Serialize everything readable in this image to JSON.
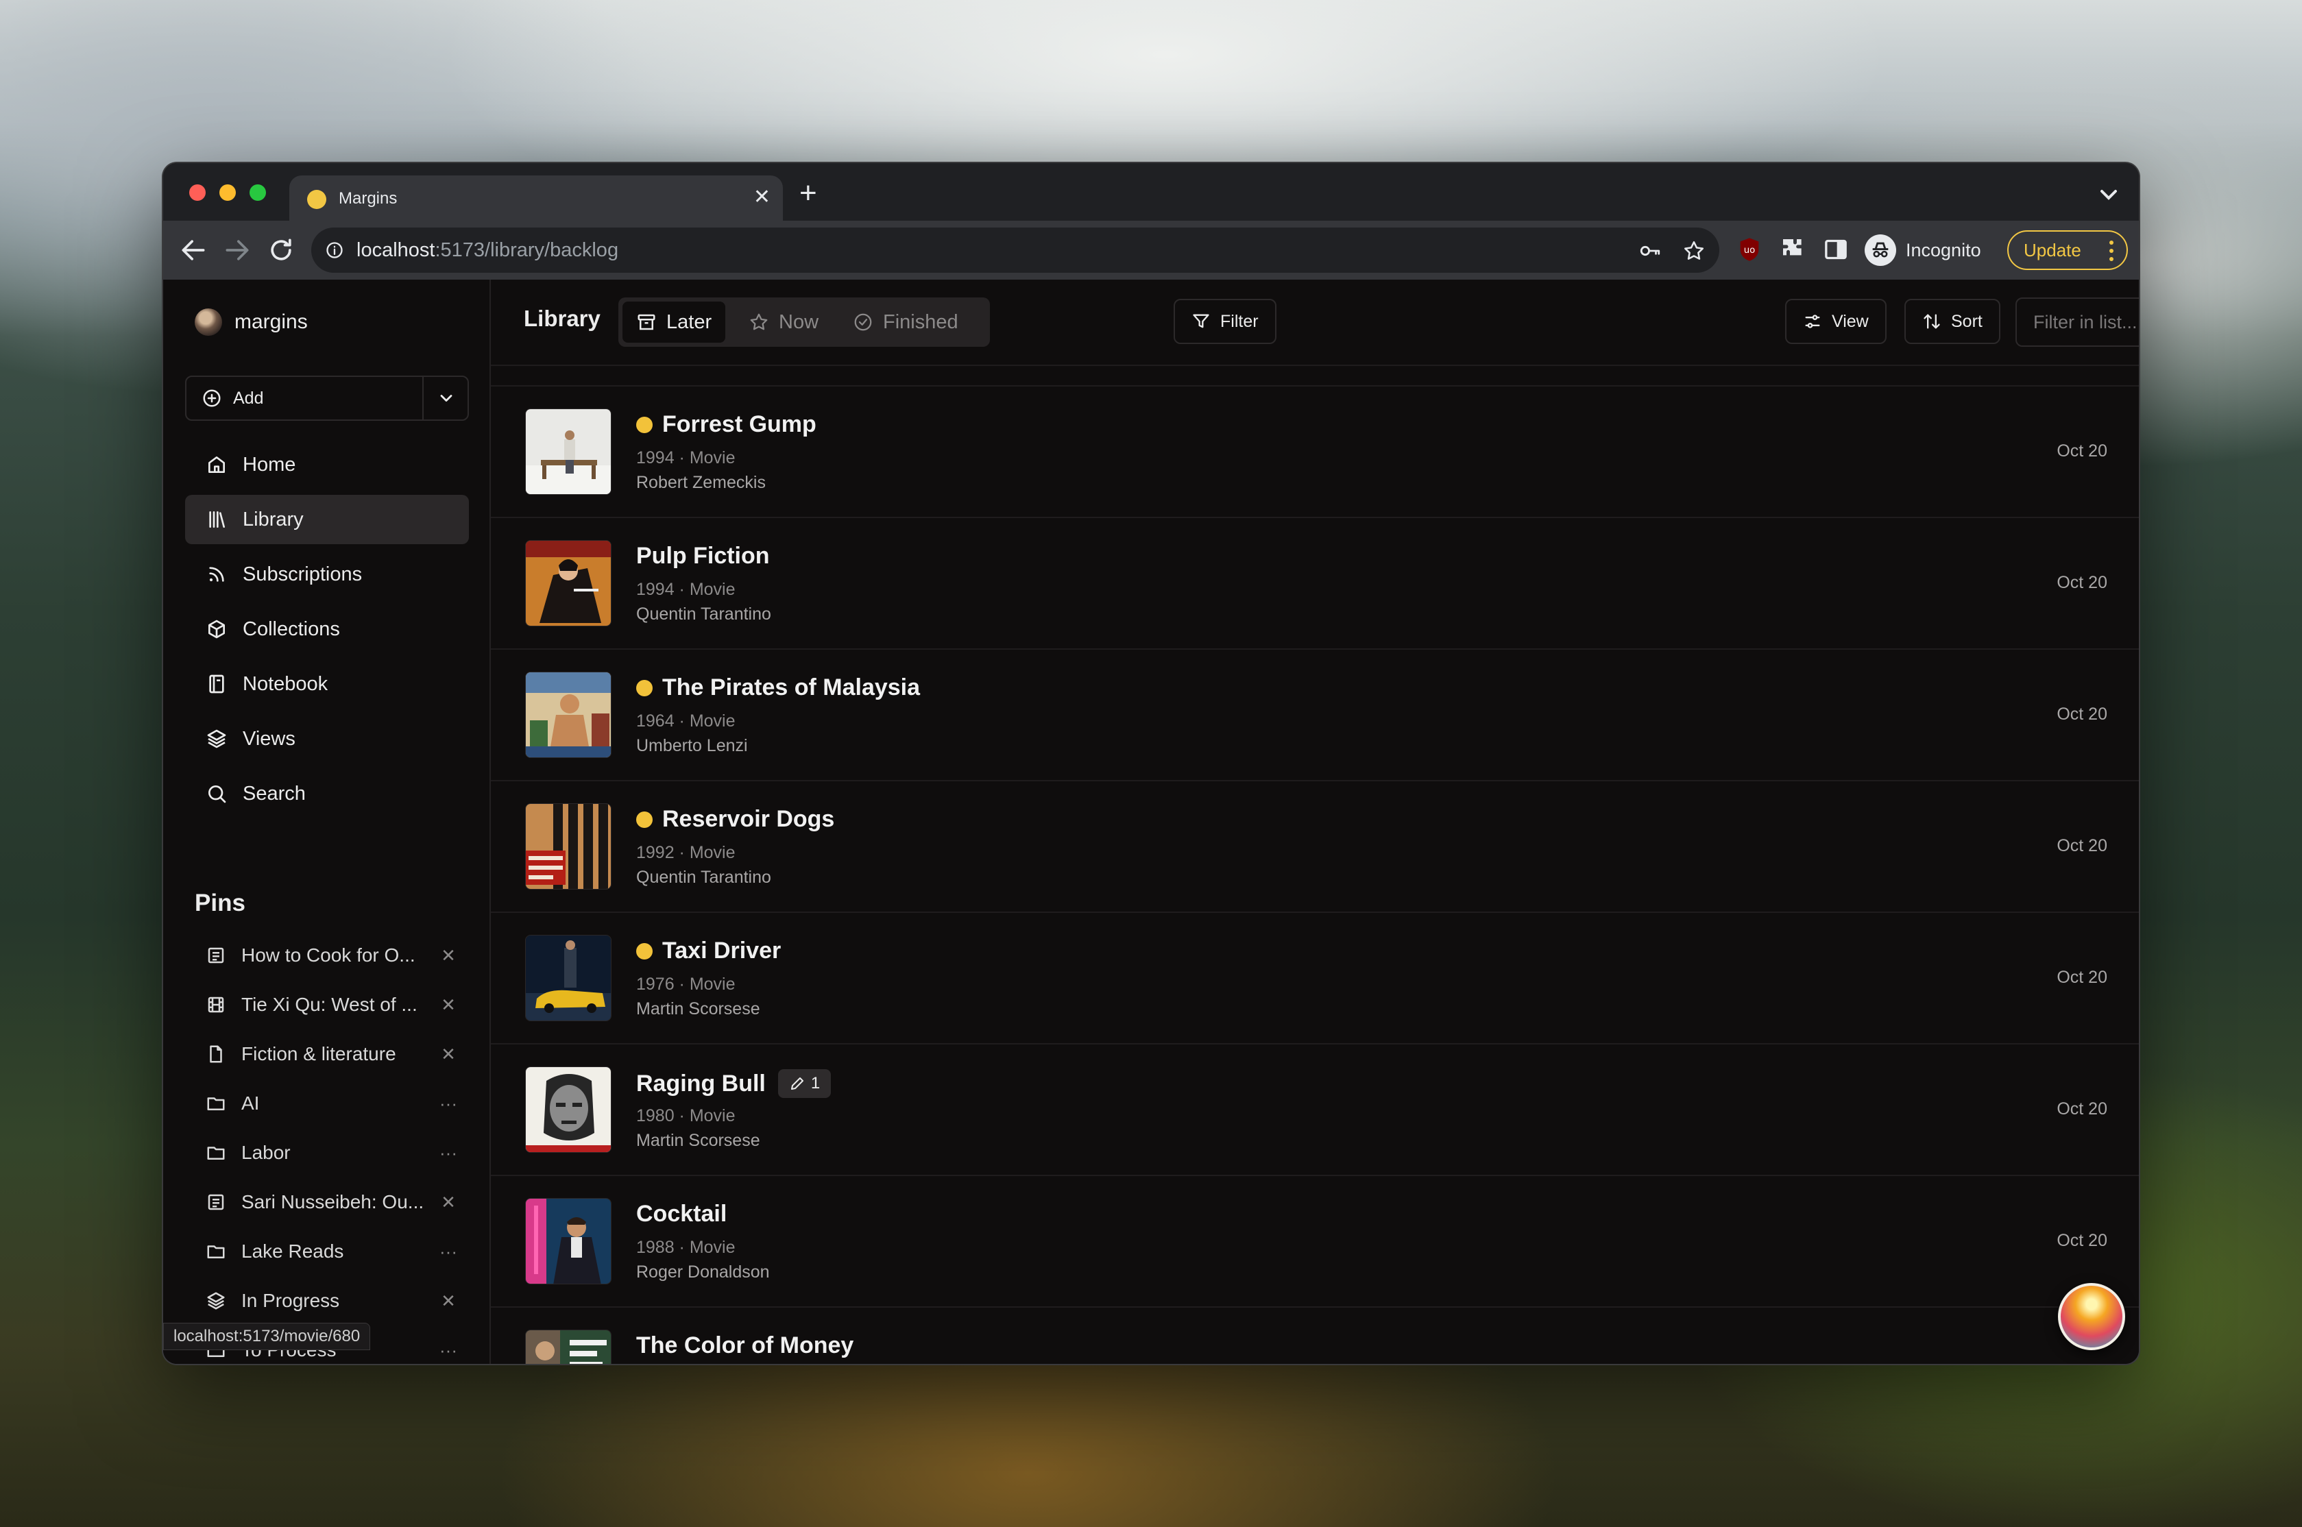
{
  "browser": {
    "tab_title": "Margins",
    "url_host": "localhost",
    "url_path": ":5173/library/backlog",
    "profile_label": "Incognito",
    "update_label": "Update",
    "status_link": "localhost:5173/movie/680"
  },
  "sidebar": {
    "brand": "margins",
    "add_label": "Add",
    "nav": [
      {
        "label": "Home",
        "icon": "home-icon"
      },
      {
        "label": "Library",
        "icon": "library-icon",
        "active": true
      },
      {
        "label": "Subscriptions",
        "icon": "rss-icon"
      },
      {
        "label": "Collections",
        "icon": "cube-icon"
      },
      {
        "label": "Notebook",
        "icon": "notebook-icon"
      },
      {
        "label": "Views",
        "icon": "layers-icon"
      },
      {
        "label": "Search",
        "icon": "search-icon"
      }
    ],
    "pins_title": "Pins",
    "pins": [
      {
        "label": "How to Cook for O...",
        "icon": "article-icon",
        "action": "remove"
      },
      {
        "label": "Tie Xi Qu: West of ...",
        "icon": "film-icon",
        "action": "remove"
      },
      {
        "label": "Fiction & literature",
        "icon": "document-icon",
        "action": "remove"
      },
      {
        "label": "AI",
        "icon": "folder-icon",
        "action": "more"
      },
      {
        "label": "Labor",
        "icon": "folder-icon",
        "action": "more"
      },
      {
        "label": "Sari Nusseibeh: Ou...",
        "icon": "article-icon",
        "action": "remove"
      },
      {
        "label": "Lake Reads",
        "icon": "folder-icon",
        "action": "more"
      },
      {
        "label": "In Progress",
        "icon": "layers-icon",
        "action": "remove"
      },
      {
        "label": "To Process",
        "icon": "folder-icon",
        "action": "more"
      }
    ]
  },
  "header": {
    "title": "Library",
    "segments": [
      {
        "label": "Later",
        "icon": "archive-icon",
        "active": true
      },
      {
        "label": "Now",
        "icon": "star-icon"
      },
      {
        "label": "Finished",
        "icon": "check-circle-icon"
      }
    ],
    "filter_label": "Filter",
    "view_label": "View",
    "sort_label": "Sort",
    "filter_placeholder": "Filter in list...",
    "shortcut": "/"
  },
  "items": [
    {
      "title": "Forrest Gump",
      "meta": "1994 · Movie",
      "creator": "Robert Zemeckis",
      "date": "Oct 20",
      "dot": true
    },
    {
      "title": "Pulp Fiction",
      "meta": "1994 · Movie",
      "creator": "Quentin Tarantino",
      "date": "Oct 20",
      "dot": false
    },
    {
      "title": "The Pirates of Malaysia",
      "meta": "1964 · Movie",
      "creator": "Umberto Lenzi",
      "date": "Oct 20",
      "dot": true
    },
    {
      "title": "Reservoir Dogs",
      "meta": "1992 · Movie",
      "creator": "Quentin Tarantino",
      "date": "Oct 20",
      "dot": true
    },
    {
      "title": "Taxi Driver",
      "meta": "1976 · Movie",
      "creator": "Martin Scorsese",
      "date": "Oct 20",
      "dot": true
    },
    {
      "title": "Raging Bull",
      "meta": "1980 · Movie",
      "creator": "Martin Scorsese",
      "date": "Oct 20",
      "dot": false,
      "notes": "1"
    },
    {
      "title": "Cocktail",
      "meta": "1988 · Movie",
      "creator": "Roger Donaldson",
      "date": "Oct 20",
      "dot": false
    },
    {
      "title": "The Color of Money",
      "meta": "",
      "creator": "",
      "date": "",
      "dot": false
    }
  ],
  "colors": {
    "accent": "#f2c23a",
    "background": "#0f0d0d",
    "update": "#f2c744"
  }
}
